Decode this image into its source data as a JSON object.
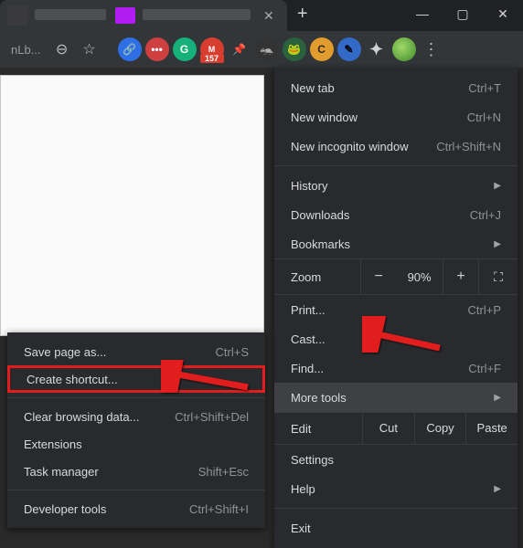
{
  "titlebar": {
    "tab_title_visible": "",
    "close": "✕",
    "newtab": "+",
    "win_min": "—",
    "win_max": "▢",
    "win_close": "✕"
  },
  "toolbar": {
    "address_fragment": "nLb...",
    "zoom_icon": "⊖",
    "star_icon": "☆",
    "gmail_badge": "157",
    "kebab": "⋮"
  },
  "menu": {
    "new_tab": {
      "label": "New tab",
      "shortcut": "Ctrl+T"
    },
    "new_window": {
      "label": "New window",
      "shortcut": "Ctrl+N"
    },
    "new_incognito": {
      "label": "New incognito window",
      "shortcut": "Ctrl+Shift+N"
    },
    "history": {
      "label": "History"
    },
    "downloads": {
      "label": "Downloads",
      "shortcut": "Ctrl+J"
    },
    "bookmarks": {
      "label": "Bookmarks"
    },
    "zoom": {
      "label": "Zoom",
      "minus": "−",
      "value": "90%",
      "plus": "+",
      "full": "⛶"
    },
    "print": {
      "label": "Print...",
      "shortcut": "Ctrl+P"
    },
    "cast": {
      "label": "Cast..."
    },
    "find": {
      "label": "Find...",
      "shortcut": "Ctrl+F"
    },
    "more_tools": {
      "label": "More tools"
    },
    "edit": {
      "label": "Edit",
      "cut": "Cut",
      "copy": "Copy",
      "paste": "Paste"
    },
    "settings": {
      "label": "Settings"
    },
    "help": {
      "label": "Help"
    },
    "exit": {
      "label": "Exit"
    }
  },
  "submenu": {
    "save_page": {
      "label": "Save page as...",
      "shortcut": "Ctrl+S"
    },
    "create_shortcut": {
      "label": "Create shortcut..."
    },
    "clear_data": {
      "label": "Clear browsing data...",
      "shortcut": "Ctrl+Shift+Del"
    },
    "extensions": {
      "label": "Extensions"
    },
    "task_manager": {
      "label": "Task manager",
      "shortcut": "Shift+Esc"
    },
    "dev_tools": {
      "label": "Developer tools",
      "shortcut": "Ctrl+Shift+I"
    }
  },
  "ext_labels": {
    "grammarly": "G",
    "canvas": "C"
  }
}
